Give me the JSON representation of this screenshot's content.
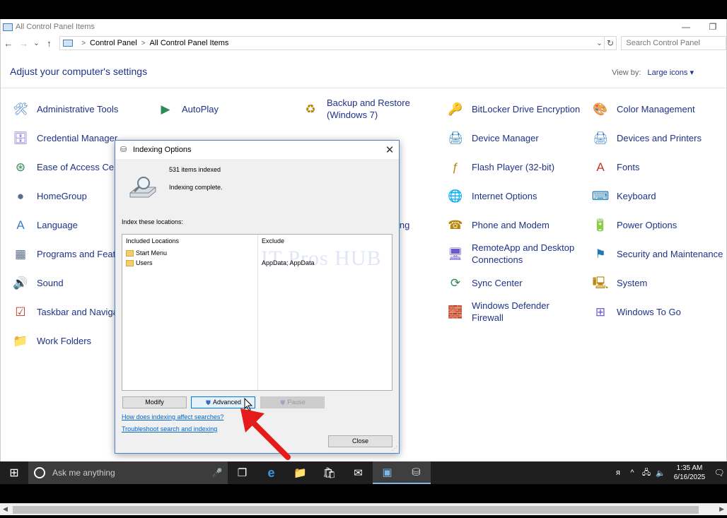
{
  "window": {
    "title": "All Control Panel Items",
    "minimize_glyph": "—",
    "restore_glyph": "❐"
  },
  "nav": {
    "back_glyph": "←",
    "forward_glyph": "→",
    "recent_glyph": "⌄",
    "up_glyph": "↑",
    "breadcrumb": [
      "Control Panel",
      "All Control Panel Items"
    ],
    "breadcrumb_sep": ">",
    "dropdown_glyph": "⌄",
    "refresh_glyph": "↻",
    "search_placeholder": "Search Control Panel"
  },
  "header": {
    "title": "Adjust your computer's settings",
    "view_by_label": "View by:",
    "view_by_value": "Large icons ▾"
  },
  "items": [
    {
      "label": "Administrative Tools",
      "icon": "admin-tools-icon",
      "glyph": "🛠"
    },
    {
      "label": "AutoPlay",
      "icon": "autoplay-icon",
      "glyph": "▶"
    },
    {
      "label": "Backup and Restore\n(Windows 7)",
      "icon": "backup-icon",
      "glyph": "♻"
    },
    {
      "label": "BitLocker Drive Encryption",
      "icon": "bitlocker-icon",
      "glyph": "🔑"
    },
    {
      "label": "Color Management",
      "icon": "color-management-icon",
      "glyph": "🎨"
    },
    {
      "label": "Credential Manager",
      "icon": "credential-manager-icon",
      "glyph": "🗄"
    },
    {
      "label": "Device Manager",
      "icon": "device-manager-icon",
      "glyph": "🖨"
    },
    {
      "label": "Devices and Printers",
      "icon": "printer-icon",
      "glyph": "🖨"
    },
    {
      "label": "Ease of Access Cent",
      "icon": "ease-of-access-icon",
      "glyph": "⊛"
    },
    {
      "label": "Flash Player (32-bit)",
      "icon": "flash-icon",
      "glyph": "ƒ"
    },
    {
      "label": "Fonts",
      "icon": "fonts-icon",
      "glyph": "A"
    },
    {
      "label": "HomeGroup",
      "icon": "homegroup-icon",
      "glyph": "●"
    },
    {
      "label": "Internet Options",
      "icon": "internet-options-icon",
      "glyph": "🌐"
    },
    {
      "label": "Keyboard",
      "icon": "keyboard-icon",
      "glyph": "⌨"
    },
    {
      "label": "Language",
      "icon": "language-icon",
      "glyph": "A"
    },
    {
      "label": "ing",
      "icon": "",
      "glyph": ""
    },
    {
      "label": "Phone and Modem",
      "icon": "phone-icon",
      "glyph": "☎"
    },
    {
      "label": "Power Options",
      "icon": "power-options-icon",
      "glyph": "🔋"
    },
    {
      "label": "Programs and Featu",
      "icon": "programs-icon",
      "glyph": "▦"
    },
    {
      "label": "RemoteApp and Desktop\nConnections",
      "icon": "remoteapp-icon",
      "glyph": "🖥"
    },
    {
      "label": "Security and Maintenance",
      "icon": "flag-icon",
      "glyph": "⚑"
    },
    {
      "label": "Sound",
      "icon": "speaker-icon",
      "glyph": "🔊"
    },
    {
      "label": "Sync Center",
      "icon": "sync-icon",
      "glyph": "⟳"
    },
    {
      "label": "System",
      "icon": "system-icon",
      "glyph": "🖳"
    },
    {
      "label": "Taskbar and Naviga",
      "icon": "taskbar-icon",
      "glyph": "☑"
    },
    {
      "label": "Windows Defender\nFirewall",
      "icon": "firewall-icon",
      "glyph": "🧱"
    },
    {
      "label": "Windows To Go",
      "icon": "windows-to-go-icon",
      "glyph": "⊞"
    },
    {
      "label": "Work Folders",
      "icon": "work-folders-icon",
      "glyph": "📁"
    }
  ],
  "dialog": {
    "title": "Indexing Options",
    "close_glyph": "✕",
    "items_indexed": "531 items indexed",
    "status": "Indexing complete.",
    "index_label": "Index these locations:",
    "columns": {
      "included": "Included Locations",
      "exclude": "Exclude"
    },
    "locations": [
      {
        "name": "Start Menu",
        "exclude": ""
      },
      {
        "name": "Users",
        "exclude": "AppData; AppData"
      }
    ],
    "watermark": "IT Pros HUB",
    "buttons": {
      "modify": "Modify",
      "advanced": "Advanced",
      "pause": "Pause",
      "close": "Close"
    },
    "links": {
      "how": "How does indexing affect searches?",
      "troubleshoot": "Troubleshoot search and indexing"
    },
    "grip_glyph": "⋰"
  },
  "taskbar": {
    "start_glyph": "⊞",
    "search_placeholder": "Ask me anything",
    "mic_glyph": "🎤",
    "apps": [
      {
        "name": "task-view-icon",
        "glyph": "❐",
        "active": false
      },
      {
        "name": "edge-icon",
        "glyph": "e",
        "active": false
      },
      {
        "name": "file-explorer-icon",
        "glyph": "📁",
        "active": false
      },
      {
        "name": "store-icon",
        "glyph": "🛍",
        "active": false
      },
      {
        "name": "mail-icon",
        "glyph": "✉",
        "active": false
      },
      {
        "name": "control-panel-icon",
        "glyph": "▣",
        "active": true
      },
      {
        "name": "indexing-options-icon",
        "glyph": "⛁",
        "active": true
      }
    ],
    "tray": {
      "people_glyph": "ᴙ",
      "chevron_glyph": "^",
      "network_glyph": "🖧",
      "volume_glyph": "🔈",
      "time": "1:35 AM",
      "date": "6/16/2025",
      "notification_glyph": "🗨"
    }
  },
  "scrollbar": {
    "left_glyph": "◀",
    "right_glyph": "▶"
  },
  "colors": {
    "link": "#1e3287",
    "accent": "#0078d7",
    "arrow": "#e41b1b"
  }
}
